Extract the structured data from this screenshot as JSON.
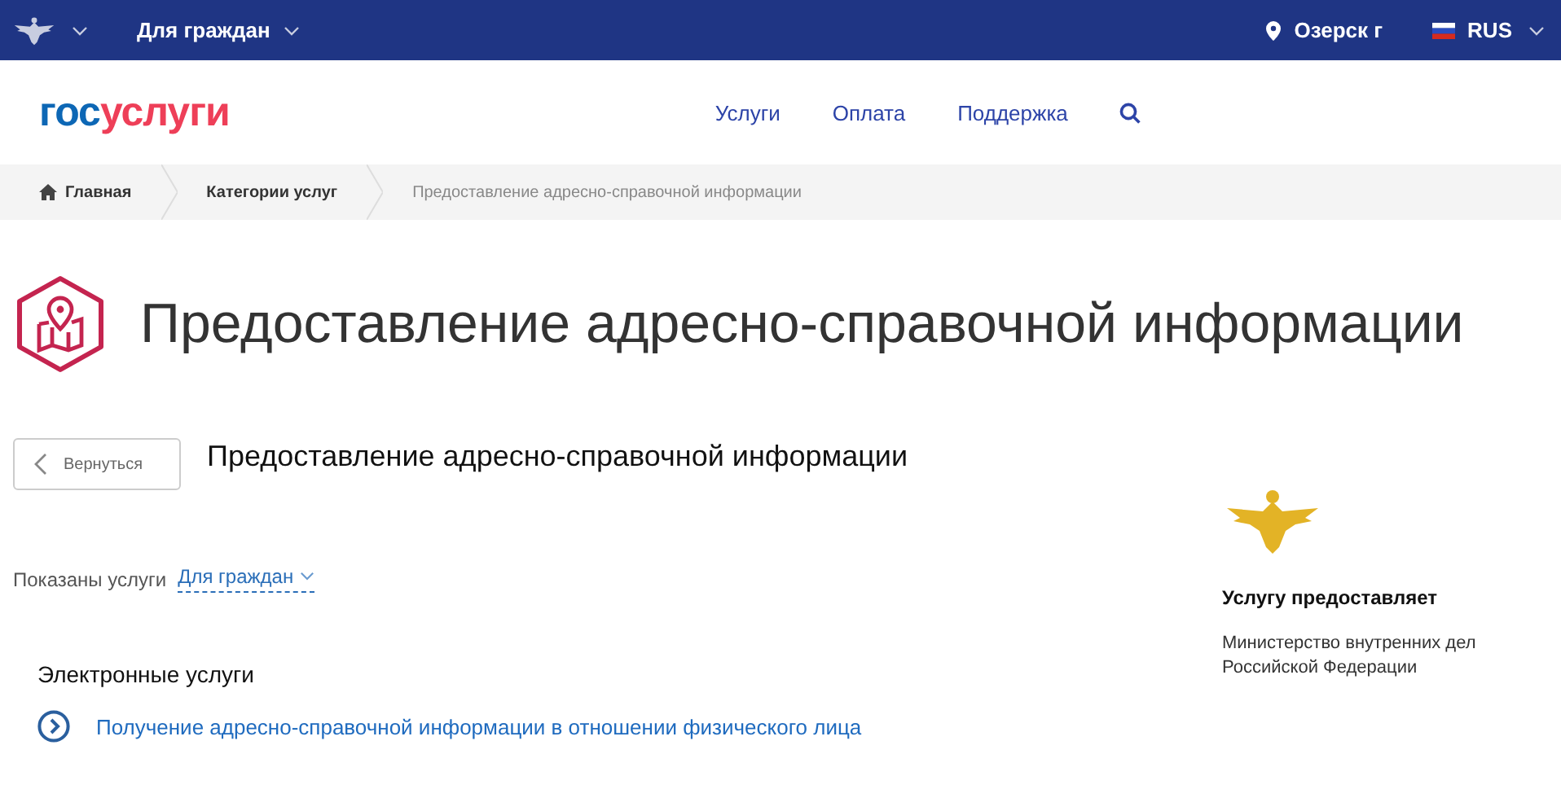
{
  "top_bar": {
    "audience": "Для граждан",
    "location": "Озерск г",
    "language": "RUS"
  },
  "header": {
    "logo": {
      "part_1": "гос",
      "part_2": "услуги"
    },
    "nav": [
      "Услуги",
      "Оплата",
      "Поддержка"
    ]
  },
  "breadcrumbs": [
    "Главная",
    "Категории услуг",
    "Предоставление адресно-справочной информации"
  ],
  "page_title": "Предоставление адресно-справочной информации",
  "back_button": "Вернуться",
  "subtitle": "Предоставление адресно-справочной информации",
  "filter": {
    "label": "Показаны услуги",
    "value": "Для граждан"
  },
  "section": {
    "title": "Электронные услуги",
    "links": [
      "Получение адресно-справочной информации в отношении физического лица"
    ]
  },
  "provider": {
    "heading": "Услугу предоставляет",
    "name": "Министерство внутренних дел Российской Федерации"
  }
}
